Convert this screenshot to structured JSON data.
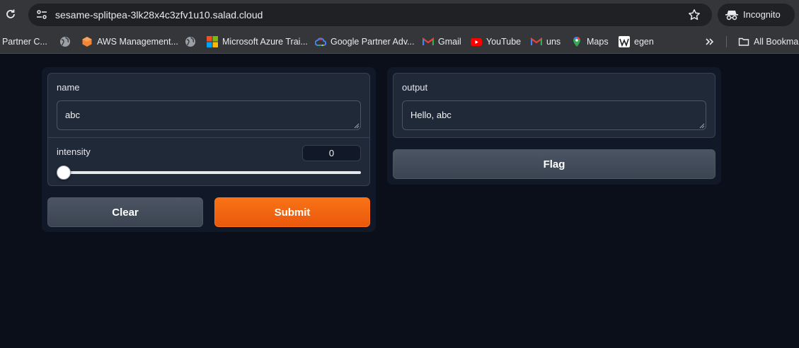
{
  "browser": {
    "url": "sesame-splitpea-3lk28x4c3zfv1u10.salad.cloud",
    "incognito_label": "Incognito",
    "bookmarks": [
      {
        "label": "t Partner C...",
        "icon": "microsoft-partner-icon"
      },
      {
        "label": "",
        "icon": "globe-icon"
      },
      {
        "label": "AWS Management...",
        "icon": "aws-icon"
      },
      {
        "label": "",
        "icon": "globe-icon"
      },
      {
        "label": "Microsoft Azure Trai...",
        "icon": "microsoft-icon"
      },
      {
        "label": "Google Partner Adv...",
        "icon": "google-cloud-icon"
      },
      {
        "label": "Gmail",
        "icon": "gmail-icon"
      },
      {
        "label": "YouTube",
        "icon": "youtube-icon"
      },
      {
        "label": "uns",
        "icon": "gmail-icon"
      },
      {
        "label": "Maps",
        "icon": "maps-icon"
      },
      {
        "label": "egen",
        "icon": "wikipedia-icon"
      },
      {
        "label": "All Bookmarks",
        "icon": "folder-icon"
      }
    ]
  },
  "inputs": {
    "name": {
      "label": "name",
      "value": "abc"
    },
    "intensity": {
      "label": "intensity",
      "value": "0",
      "slider_fraction": 0
    }
  },
  "outputs": {
    "output": {
      "label": "output",
      "value": "Hello, abc"
    }
  },
  "buttons": {
    "clear": "Clear",
    "submit": "Submit",
    "flag": "Flag"
  },
  "colors": {
    "background": "#0b0f19",
    "panel": "#111827",
    "block": "#1f2937",
    "primary": "#f97316",
    "secondary": "#4b5563"
  }
}
